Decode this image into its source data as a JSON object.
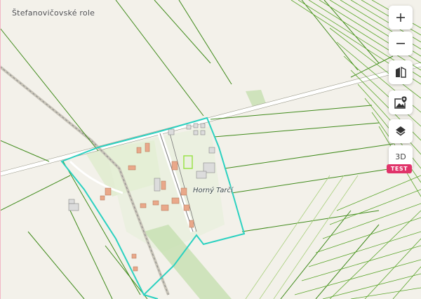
{
  "map": {
    "place_label": "Štefanovičovské role",
    "village_label": "Horný Tarčí"
  },
  "controls": {
    "zoom_in": "+",
    "zoom_out": "−",
    "three_d_label": "3D",
    "test_badge": "TEST"
  },
  "colors": {
    "parcel_line": "#3f8a1a",
    "boundary": "#2bd1c0",
    "field_green": "#c7e3a4",
    "building": "#e9a88a",
    "badge": "#e0336a"
  },
  "icons": [
    "zoom-in-icon",
    "zoom-out-icon",
    "compare-icon",
    "map-pin-photo-icon",
    "layers-icon"
  ]
}
